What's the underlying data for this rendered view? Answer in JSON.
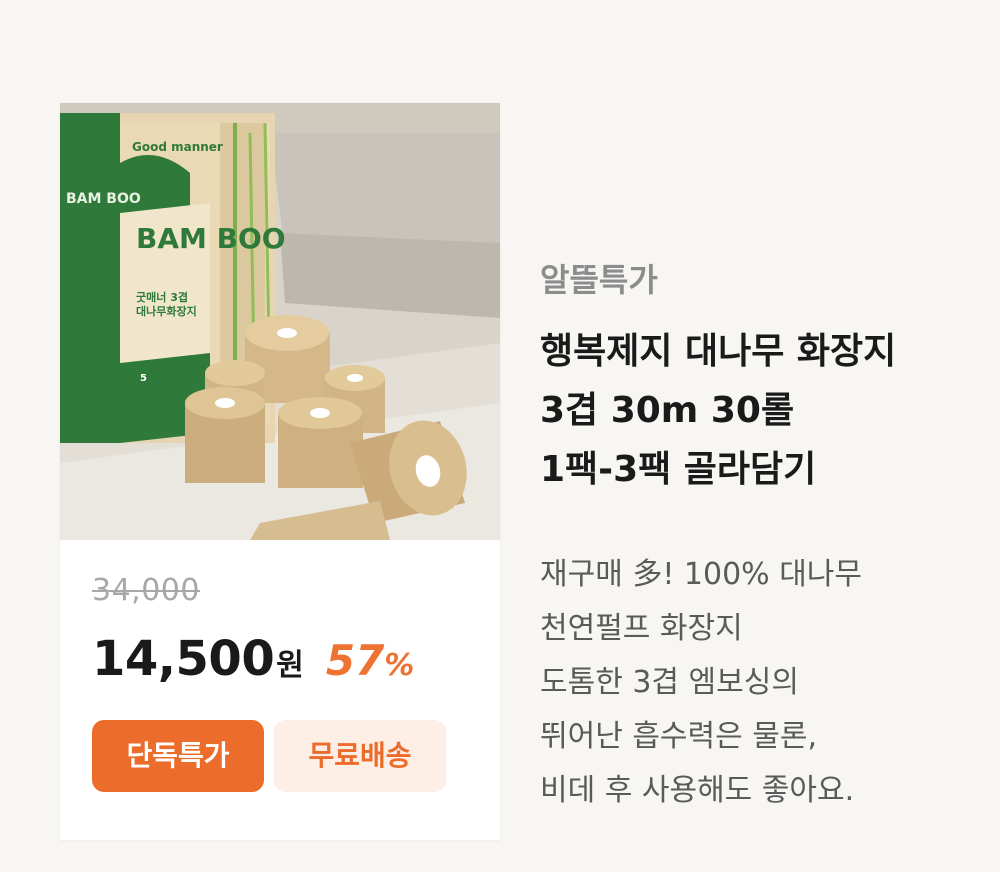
{
  "product": {
    "image_brand": "Good manner",
    "image_text_main": "BAM BOO",
    "image_text_side": "BAM BOO",
    "image_text_sub1": "굿매너 3겹",
    "image_text_sub2": "대나무화장지",
    "image_pack": "5",
    "original_price": "34,000",
    "price": "14,500",
    "currency": "원",
    "discount_value": "57",
    "discount_unit": "%",
    "badges": [
      "단독특가",
      "무료배송"
    ],
    "category": "알뜰특가",
    "title_lines": [
      "행복제지 대나무 화장지",
      "3겹 30m 30롤",
      "1팩-3팩 골라담기"
    ],
    "description_lines": [
      "재구매 多! 100% 대나무",
      "천연펄프 화장지",
      "도톰한 3겹 엠보싱의",
      "뛰어난 흡수력은 물론,",
      "비데 후 사용해도 좋아요."
    ]
  },
  "colors": {
    "accent": "#ec6d2b",
    "accent_light": "#fdeee6",
    "discount": "#ee7333",
    "background": "#f8f6f3"
  }
}
